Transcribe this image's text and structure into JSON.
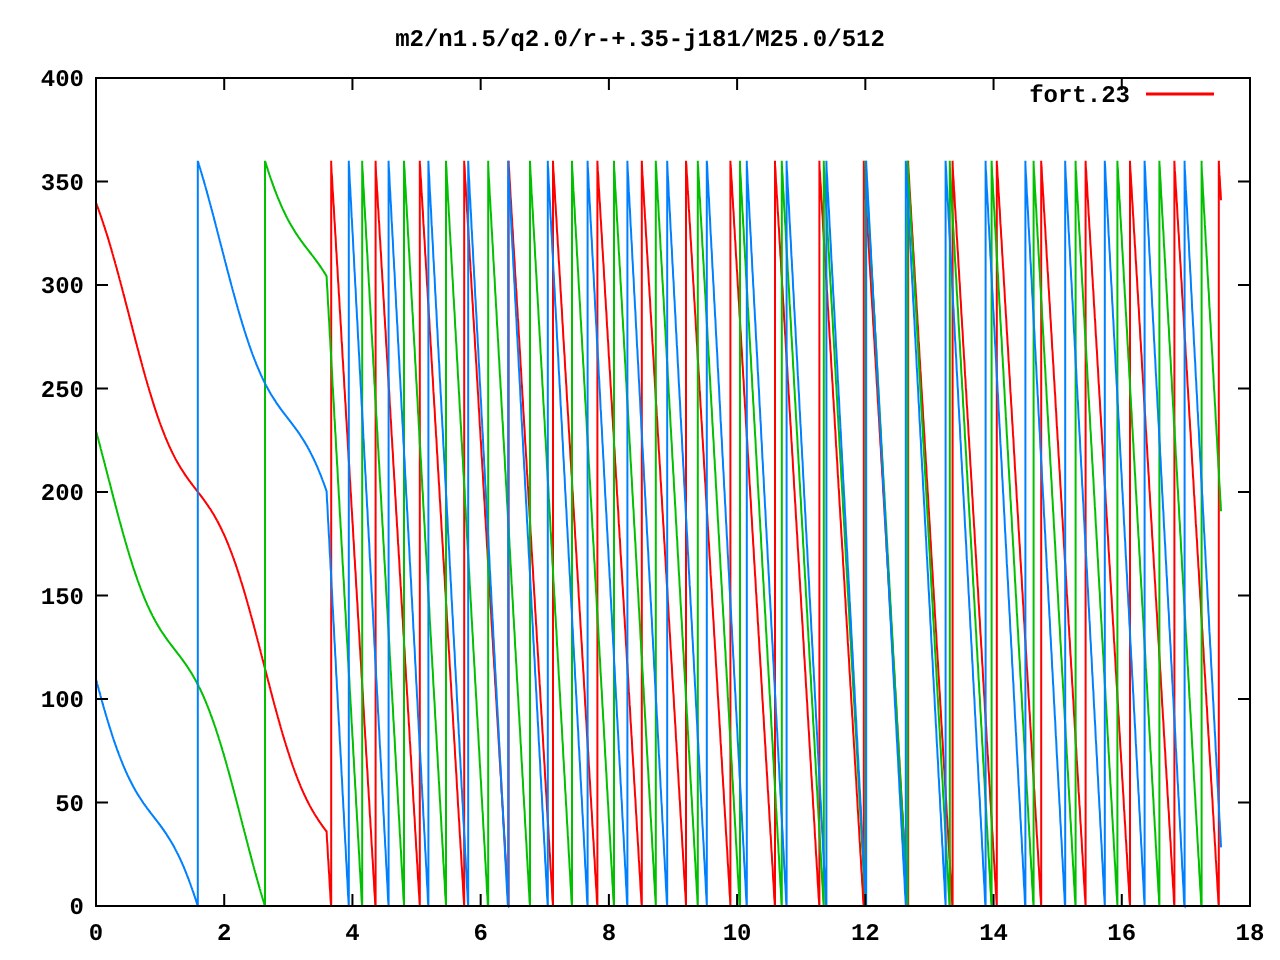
{
  "plot": {
    "title": "m2/n1.5/q2.0/r-+.35-j181/M25.0/512",
    "y_axis_labels": [
      "400",
      "350",
      "300",
      "250",
      "200",
      "150",
      "100",
      "50",
      "0"
    ],
    "x_axis_labels": [
      "0",
      "2",
      "4",
      "6",
      "8",
      "10",
      "12",
      "14",
      "16",
      "18"
    ],
    "legend": [
      {
        "label": "fort.23"
      }
    ]
  }
}
